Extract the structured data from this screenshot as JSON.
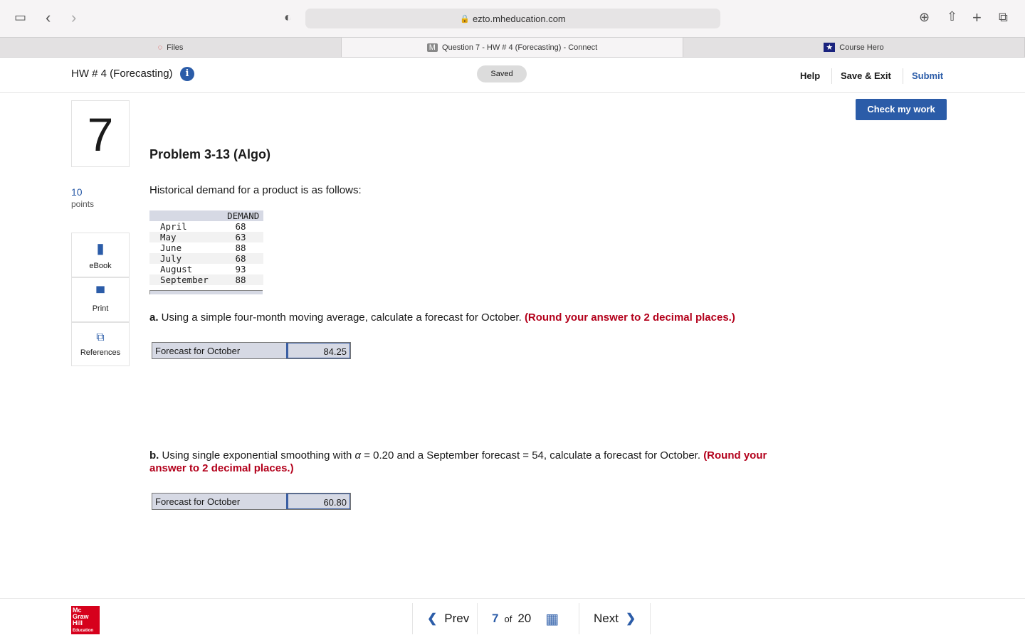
{
  "browser": {
    "url": "ezto.mheducation.com",
    "tabs": [
      {
        "label": "Files"
      },
      {
        "label": "Question 7 - HW # 4 (Forecasting) - Connect"
      },
      {
        "label": "Course Hero"
      }
    ]
  },
  "header": {
    "title": "HW # 4 (Forecasting)",
    "status": "Saved",
    "help": "Help",
    "save_exit": "Save & Exit",
    "submit": "Submit"
  },
  "question": {
    "number": "7",
    "points": "10",
    "points_label": "points",
    "check_label": "Check my work",
    "title": "Problem 3-13 (Algo)",
    "intro": "Historical demand for a product is as follows:"
  },
  "sidebar": {
    "items": [
      {
        "label": "eBook"
      },
      {
        "label": "Print"
      },
      {
        "label": "References"
      }
    ]
  },
  "demand_table": {
    "header": "DEMAND",
    "rows": [
      {
        "month": "April",
        "value": "68"
      },
      {
        "month": "May",
        "value": "63"
      },
      {
        "month": "June",
        "value": "88"
      },
      {
        "month": "July",
        "value": "68"
      },
      {
        "month": "August",
        "value": "93"
      },
      {
        "month": "September",
        "value": "88"
      }
    ]
  },
  "part_a": {
    "letter": "a.",
    "text": " Using a simple four-month moving average, calculate a forecast for October. ",
    "hint": "(Round your answer to 2 decimal places.)",
    "label": "Forecast for October",
    "value": "84.25"
  },
  "part_b": {
    "letter": "b.",
    "text_pre": " Using single exponential smoothing with ",
    "alpha": "α",
    "text_post": " = 0.20 and a September forecast = 54, calculate a forecast for October. ",
    "hint": "(Round your answer to 2 decimal places.)",
    "label": "Forecast for October",
    "value": "60.80"
  },
  "footer": {
    "prev": "Prev",
    "current": "7",
    "of": "of",
    "total": "20",
    "next": "Next",
    "logo": "Mc Graw Hill Education"
  },
  "colors": {
    "accent": "#2b5ca8",
    "hint": "#b3001b"
  }
}
